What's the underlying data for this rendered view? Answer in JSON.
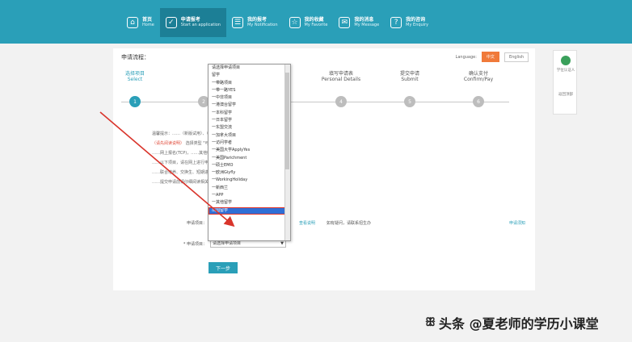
{
  "nav": {
    "items": [
      {
        "cn": "首页",
        "en": "Home",
        "icon": "⌂",
        "active": false
      },
      {
        "cn": "申请报考",
        "en": "Start an application",
        "icon": "✓",
        "active": true
      },
      {
        "cn": "我的报考",
        "en": "My Notification",
        "icon": "☰",
        "active": false
      },
      {
        "cn": "我的收藏",
        "en": "My Favorite",
        "icon": "☆",
        "active": false
      },
      {
        "cn": "我的消息",
        "en": "My Message",
        "icon": "✉",
        "active": false
      },
      {
        "cn": "我的咨询",
        "en": "My Enquiry",
        "icon": "?",
        "active": false
      }
    ]
  },
  "panel": {
    "title": "申请流程：",
    "lang_label": "Language:",
    "lang_cn": "中文",
    "lang_en": "English"
  },
  "steps": [
    {
      "cn": "选择项目",
      "en": "Select",
      "num": "1",
      "active": true
    },
    {
      "cn": "",
      "en": "",
      "num": "2",
      "active": false
    },
    {
      "cn": "填写个人信息",
      "en": "Load",
      "num": "3",
      "active": false
    },
    {
      "cn": "填写申请表",
      "en": "Personal Details",
      "num": "4",
      "active": false
    },
    {
      "cn": "提交申请",
      "en": "Submit",
      "num": "5",
      "active": false
    },
    {
      "cn": "确认支付",
      "en": "Confirm/Pay",
      "num": "6",
      "active": false
    }
  ],
  "info": {
    "line1": "温馨提示：……（新版试用）、（旧版试用）。",
    "line1_red": "（请先阅读说明）",
    "line2": "选择类型 \"可申请以下项目\"",
    "line3": "……网上报名(TCP)，……其他申请流程，请按照说明进行……",
    "line4": "……以下项目，请在网上进行申请……",
    "line5": "……联合培养、交换生、短期进修等……",
    "line6": "……提交申请前请仔细阅读相关说明……"
  },
  "form": {
    "type_label": "申请项目：",
    "type_links": [
      "查看说明",
      "如有疑问，请联系招生办"
    ],
    "type_right": "申请须知",
    "project_label": "* 申请项目：",
    "project_value": "请选择申请项目",
    "next_label": "下一步"
  },
  "dropdown": {
    "items": [
      "请选择申请项目",
      "留学",
      "一带路项目",
      "一带一路YES",
      "一中非项目",
      "一港澳台留学",
      "一本科留学",
      "一日本留学",
      "一东盟交流",
      "一加拿大项目",
      "一访问学者",
      "一美国大学ApplyYes",
      "一美国Parichment",
      "一硕士EMO",
      "一欧洲Giyfly",
      "一WorkingHoliday",
      "一新西兰",
      "一APP",
      "一其他留学",
      "出国留学"
    ],
    "selected_index": 19
  },
  "sidebar": {
    "label1": "学位认证人",
    "label2": "返回顶部"
  },
  "watermark": {
    "text": "头条 @夏老师的学历小课堂"
  },
  "colors": {
    "primary": "#2a9fb8",
    "active_nav": "#1c7f96",
    "accent": "#f07a3a",
    "highlight": "#e0332a",
    "selected": "#2f6fd6"
  }
}
